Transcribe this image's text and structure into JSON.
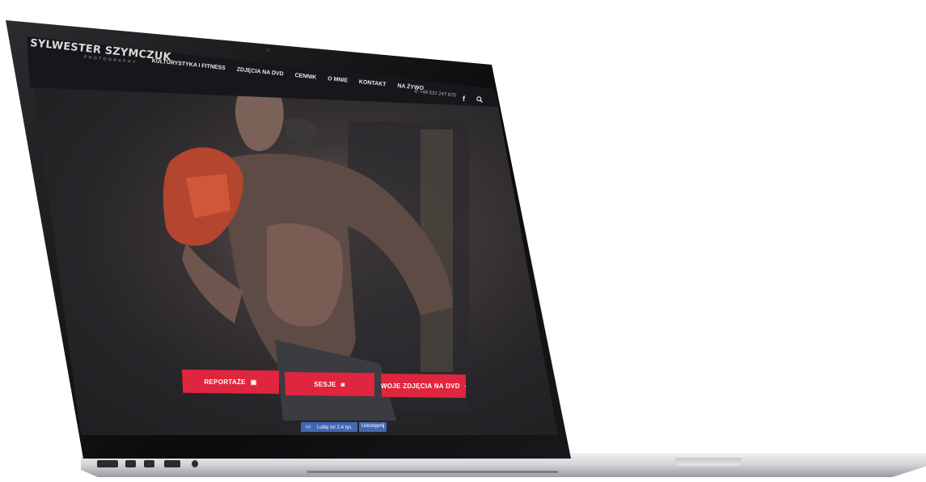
{
  "header": {
    "logo_title": "SYLWESTER SZYMCZUK",
    "logo_subtitle": "PHOTOGRAPHY",
    "phone": "+48 531 247 670"
  },
  "nav": {
    "items": [
      {
        "label": "KULTURYSTYKA I FITNESS"
      },
      {
        "label": "ZDJĘCIA NA DVD"
      },
      {
        "label": "CENNIK"
      },
      {
        "label": "O MNIE"
      },
      {
        "label": "KONTAKT"
      },
      {
        "label": "NA ŻYWO"
      }
    ]
  },
  "hero": {
    "buttons": [
      {
        "label": "REPORTAŻE",
        "icon": "image-icon"
      },
      {
        "label": "SESJE",
        "icon": "camera-icon"
      },
      {
        "label": "TWOJE ZDJĘCIA NA DVD",
        "icon": "megaphone-icon"
      }
    ]
  },
  "social": {
    "like_label": "Lubię to! 2,4 tys.",
    "share_label": "Udostępnij"
  },
  "colors": {
    "accent": "#e0253e",
    "nav_bg": "#16171a",
    "facebook": "#4267b2"
  }
}
